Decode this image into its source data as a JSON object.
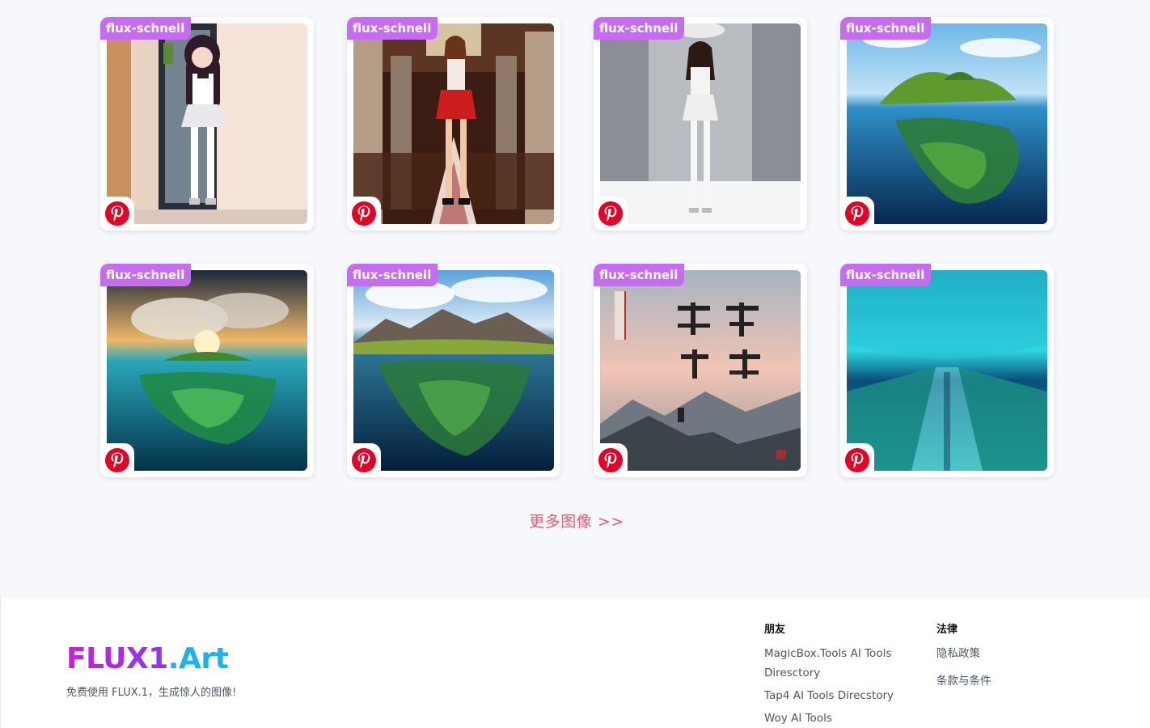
{
  "gallery": {
    "cards": [
      {
        "model": "flux-schnell",
        "art": "anime-girl-doorway"
      },
      {
        "model": "flux-schnell",
        "art": "woman-red-skirt-hall"
      },
      {
        "model": "flux-schnell",
        "art": "woman-white-room"
      },
      {
        "model": "flux-schnell",
        "art": "island-half-underwater"
      },
      {
        "model": "flux-schnell",
        "art": "island-sunset-underwater"
      },
      {
        "model": "flux-schnell",
        "art": "mountain-island-underwater"
      },
      {
        "model": "flux-schnell",
        "art": "chinese-calligraphy-mountains"
      },
      {
        "model": "flux-schnell",
        "art": "underwater-cyan-reef"
      }
    ],
    "more_label": "更多图像 >>"
  },
  "footer": {
    "brand_part1": "FLUX1",
    "brand_part2": ".Art",
    "tagline": "免费使用 FLUX.1，生成惊人的图像!",
    "friends": {
      "title": "朋友",
      "links": [
        "MagicBox.Tools AI Tools Diresctory",
        "Tap4 AI Tools Direcstory",
        "Woy AI Tools"
      ]
    },
    "legal": {
      "title": "法律",
      "links": [
        "隐私政策",
        "条款与条件"
      ]
    }
  },
  "colors": {
    "badge": "#c56cf0",
    "more_link": "#ef5b6a",
    "brand_pink": "#d01bd9",
    "brand_blue": "#1ab2f0",
    "pinterest": "#e60023"
  },
  "icons": {
    "pin": "pinterest-icon"
  }
}
